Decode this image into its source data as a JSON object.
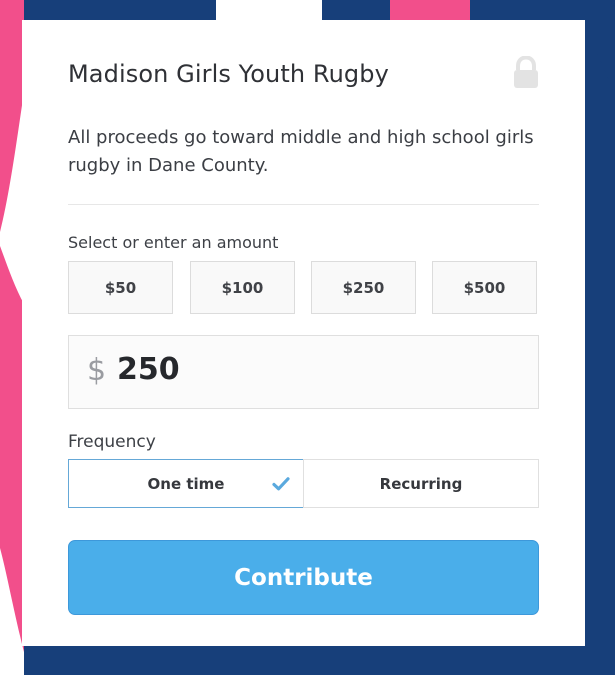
{
  "form": {
    "title": "Madison Girls Youth Rugby",
    "description": "All proceeds go toward middle and high school girls rugby in Dane County.",
    "amount_section_label": "Select or enter an amount",
    "amount_options": [
      "$50",
      "$100",
      "$250",
      "$500"
    ],
    "amount_input": {
      "currency_symbol": "$",
      "value": "250"
    },
    "frequency_label": "Frequency",
    "frequency_options": [
      "One time",
      "Recurring"
    ],
    "selected_frequency": "One time",
    "submit_label": "Contribute"
  },
  "icons": {
    "secure": "lock-icon",
    "selected_frequency": "check-icon"
  },
  "colors": {
    "accent_blue": "#4aaeea",
    "background_navy": "#173f7a",
    "background_pink": "#f24f8b"
  }
}
